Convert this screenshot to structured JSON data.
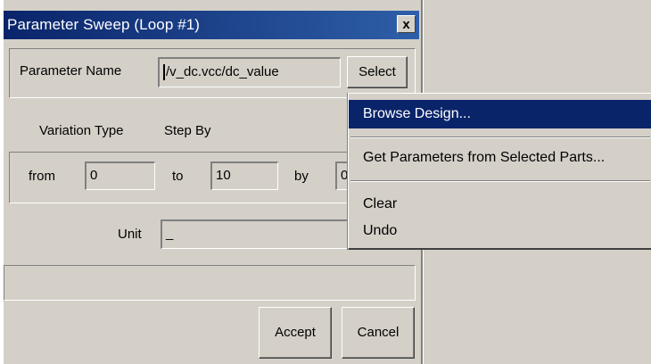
{
  "window": {
    "title": "Parameter Sweep (Loop #1)",
    "close_glyph": "x"
  },
  "form": {
    "parameter_name_label": "Parameter Name",
    "parameter_name_value": "/v_dc.vcc/dc_value",
    "select_button": "Select",
    "variation_type_label": "Variation Type",
    "variation_type_value": "Step By",
    "from_label": "from",
    "from_value": "0",
    "to_label": "to",
    "to_value": "10",
    "by_label": "by",
    "by_value": "0",
    "unit_label": "Unit",
    "unit_value": "_",
    "status_text": ""
  },
  "buttons": {
    "accept": "Accept",
    "cancel": "Cancel"
  },
  "context_menu": {
    "items": [
      {
        "label": "Browse Design...",
        "highlighted": true
      },
      {
        "label": "Get Parameters from Selected Parts..."
      },
      {
        "label": "Clear"
      },
      {
        "label": "Undo"
      }
    ]
  },
  "colors": {
    "titlebar": "#0a246a",
    "highlight": "#0a246a",
    "face": "#d4d0c8"
  }
}
